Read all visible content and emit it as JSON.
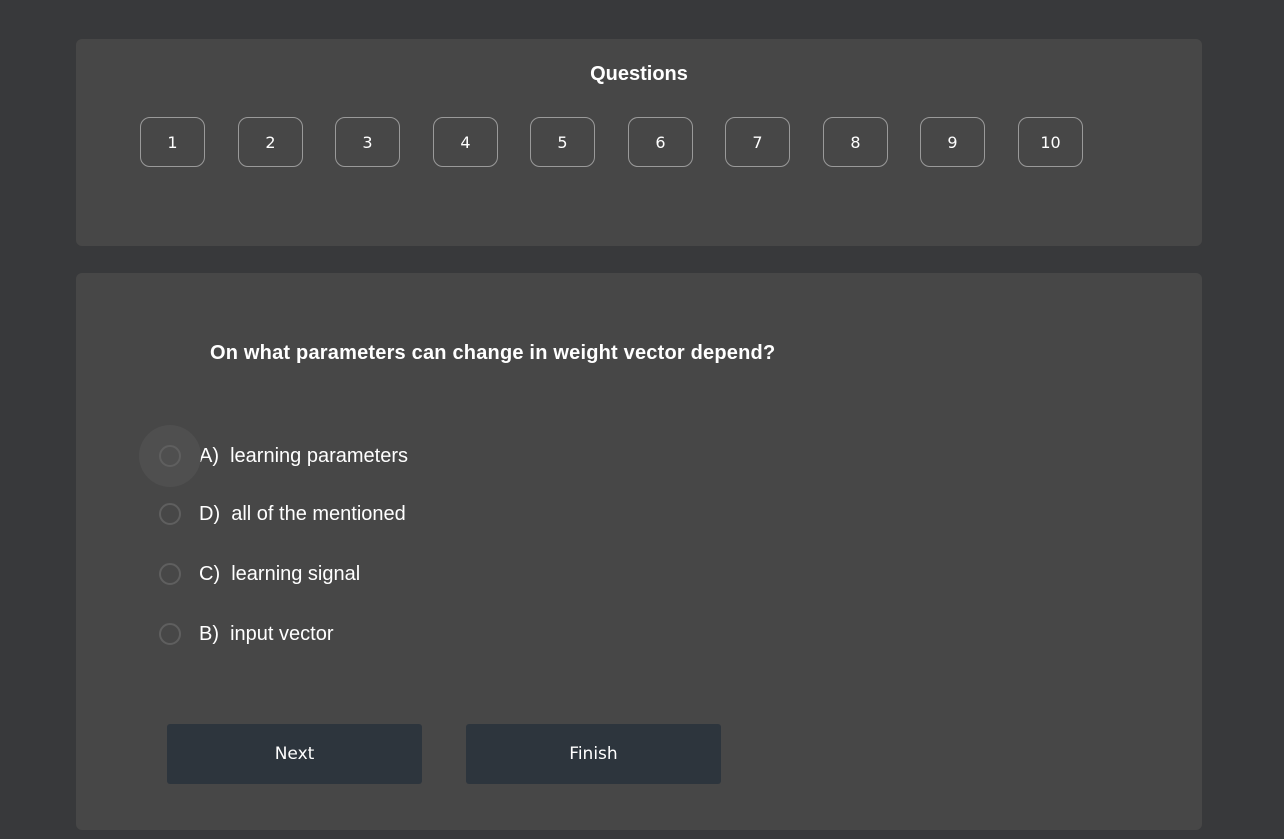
{
  "nav": {
    "title": "Questions",
    "numbers": [
      "1",
      "2",
      "3",
      "4",
      "5",
      "6",
      "7",
      "8",
      "9",
      "10"
    ]
  },
  "question": {
    "text": "On what parameters can change in weight vector depend?",
    "options": [
      {
        "label": "A)  learning parameters"
      },
      {
        "label": "D)  all of the mentioned"
      },
      {
        "label": "C)  learning signal"
      },
      {
        "label": "B)  input vector"
      }
    ]
  },
  "buttons": {
    "next_label": "Next",
    "finish_label": "Finish"
  },
  "colors": {
    "background": "#38393b",
    "panel": "#474747",
    "button": "#2d353d"
  }
}
